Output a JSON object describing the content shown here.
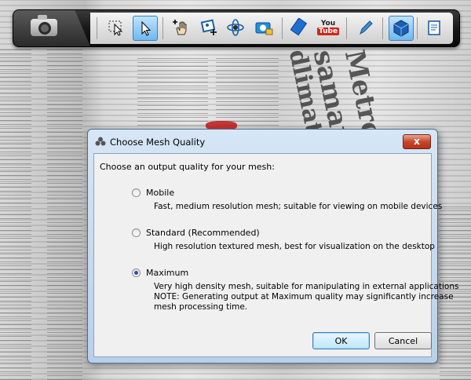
{
  "background": {
    "headlines": [
      "Metro oc",
      "samarb",
      "dlimate"
    ]
  },
  "toolbar": {
    "buttons": [
      {
        "name": "camera-icon"
      },
      {
        "name": "select-rectangle-icon"
      },
      {
        "name": "pointer-select-icon",
        "active": true
      },
      {
        "name": "add-hand-icon"
      },
      {
        "name": "add-photo-icon"
      },
      {
        "name": "orbit-icon"
      },
      {
        "name": "camera-lock-icon"
      },
      {
        "name": "film-icon"
      },
      {
        "name": "youtube-icon",
        "label": "You Tube"
      },
      {
        "name": "pen-icon"
      },
      {
        "name": "cube-mesh-icon",
        "active": true
      },
      {
        "name": "notes-icon"
      }
    ]
  },
  "dialog": {
    "title": "Choose Mesh Quality",
    "close_label": "x",
    "prompt": "Choose an output quality for your mesh:",
    "options": [
      {
        "label": "Mobile",
        "description": [
          "Fast, medium resolution mesh; suitable for viewing on mobile devices"
        ],
        "checked": false
      },
      {
        "label": "Standard (Recommended)",
        "description": [
          "High resolution textured mesh, best for visualization on the desktop"
        ],
        "checked": false
      },
      {
        "label": "Maximum",
        "description": [
          "Very high density mesh, suitable for manipulating in external applications",
          "NOTE: Generating output at Maximum quality may significantly increase",
          "mesh processing time."
        ],
        "checked": true
      }
    ],
    "ok_label": "OK",
    "cancel_label": "Cancel"
  },
  "colors": {
    "accent": "#2b4fa8",
    "close": "#c8452b"
  }
}
